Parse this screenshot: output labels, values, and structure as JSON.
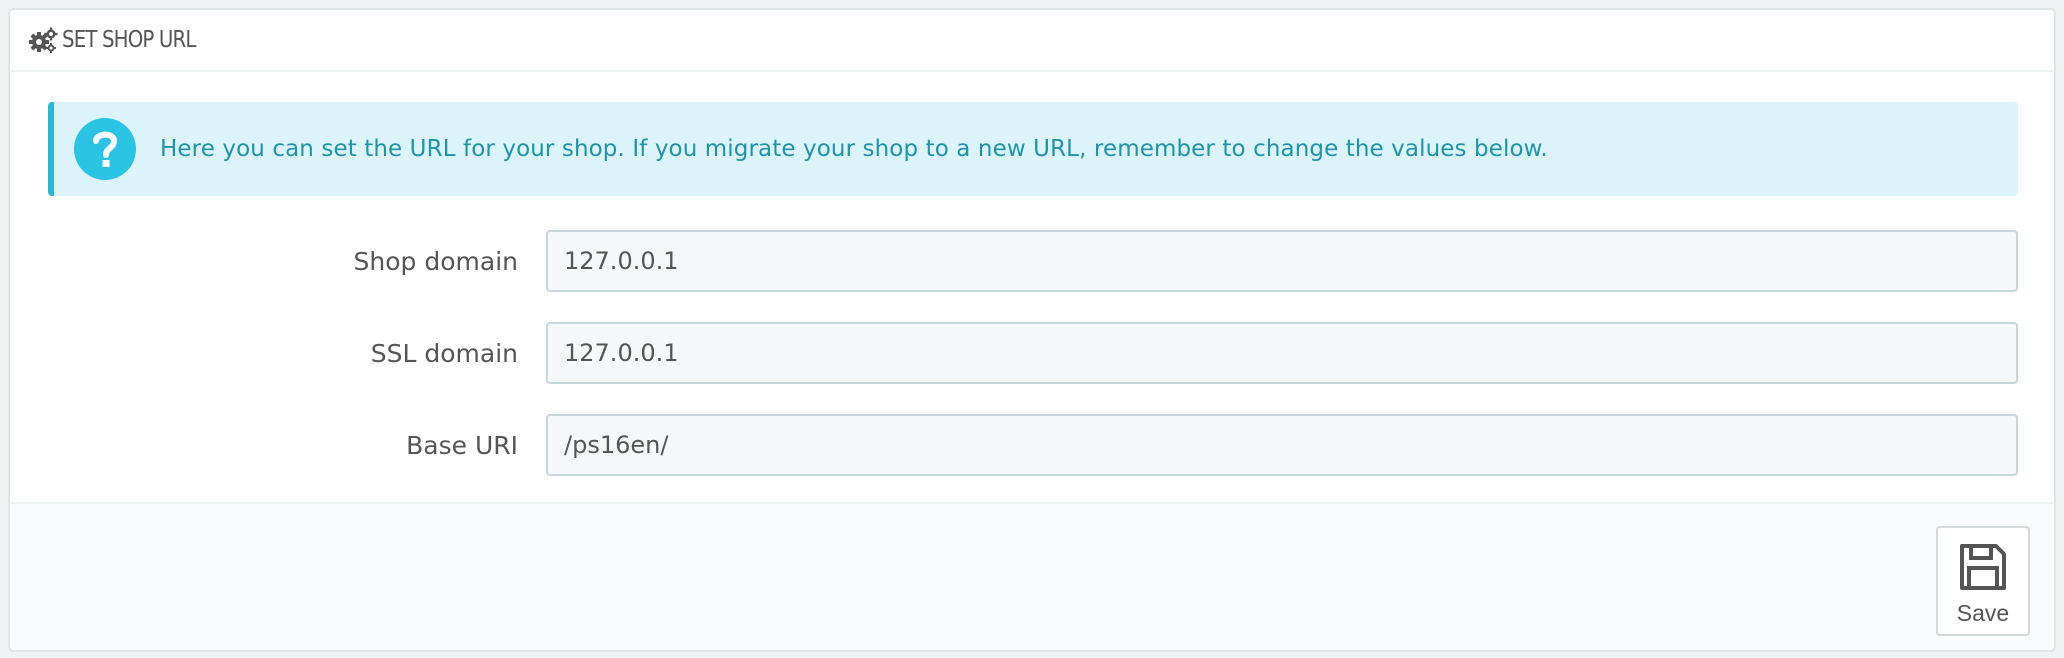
{
  "panel": {
    "title": "SET SHOP URL",
    "icon": "cogs-icon"
  },
  "alert": {
    "icon": "question-circle-icon",
    "text": "Here you can set the URL for your shop. If you migrate your shop to a new URL, remember to change the values below.",
    "color": "#25b9d7"
  },
  "form": {
    "fields": [
      {
        "label": "Shop domain",
        "value": "127.0.0.1"
      },
      {
        "label": "SSL domain",
        "value": "127.0.0.1"
      },
      {
        "label": "Base URI",
        "value": "/ps16en/"
      }
    ]
  },
  "footer": {
    "save_label": "Save",
    "save_icon": "floppy-disk-icon"
  }
}
